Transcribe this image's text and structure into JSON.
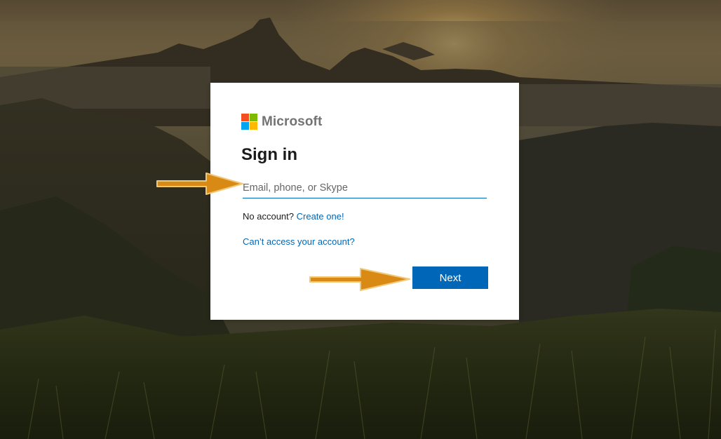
{
  "brand": {
    "name": "Microsoft",
    "logo_colors": [
      "#f25022",
      "#7fba00",
      "#00a4ef",
      "#ffb900"
    ]
  },
  "signin": {
    "title": "Sign in",
    "email_placeholder": "Email, phone, or Skype",
    "email_value": "",
    "no_account_text": "No account?",
    "create_link": "Create one!",
    "cant_access_link": "Can’t access your account?",
    "next_label": "Next"
  },
  "colors": {
    "accent": "#0067b8",
    "arrow": "#d98a14"
  },
  "annotations": {
    "arrow_icon": "arrow-right-icon"
  }
}
